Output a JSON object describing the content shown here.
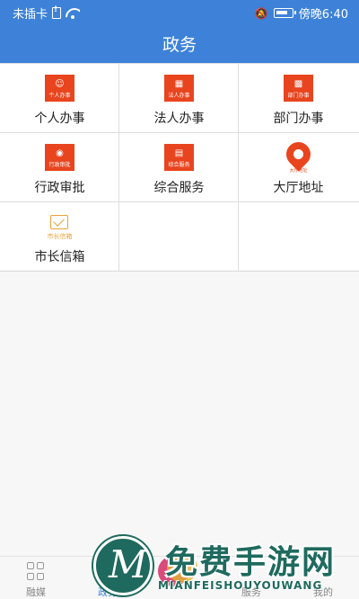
{
  "status_bar": {
    "carrier": "未插卡",
    "time": "傍晚6:40",
    "icons": [
      "sim-icon",
      "wifi-icon",
      "mute-icon",
      "battery-icon"
    ]
  },
  "header": {
    "title": "政务"
  },
  "grid": {
    "items": [
      {
        "label": "个人办事",
        "icon_text": "个人办事",
        "icon": "person-icon"
      },
      {
        "label": "法人办事",
        "icon_text": "法人办事",
        "icon": "briefcase-icon"
      },
      {
        "label": "部门办事",
        "icon_text": "部门办事",
        "icon": "building-icon"
      },
      {
        "label": "行政审批",
        "icon_text": "行政审批",
        "icon": "stamp-icon"
      },
      {
        "label": "综合服务",
        "icon_text": "综合服务",
        "icon": "service-icon"
      },
      {
        "label": "大厅地址",
        "icon_text": "大厅地址",
        "icon": "location-pin-icon"
      },
      {
        "label": "市长信箱",
        "icon_text": "市长信箱",
        "icon": "mailbox-icon"
      }
    ]
  },
  "tabbar": {
    "tabs": [
      {
        "label": "融媒",
        "icon": "grid-icon",
        "active": false
      },
      {
        "label": "政务",
        "icon": "government-icon",
        "active": true
      },
      {
        "label": "",
        "icon": "center-icon",
        "active": false
      },
      {
        "label": "服务",
        "icon": "heart-icon",
        "active": false
      },
      {
        "label": "我的",
        "icon": "profile-icon",
        "active": false
      }
    ]
  },
  "watermark": {
    "text": "免费手游网",
    "subtext": "MIANFEISHOUYOUWANG"
  },
  "colors": {
    "primary": "#3d82d8",
    "icon_red": "#e8451f",
    "icon_gold": "#e8a23a",
    "watermark_green": "#1f6a5e"
  }
}
